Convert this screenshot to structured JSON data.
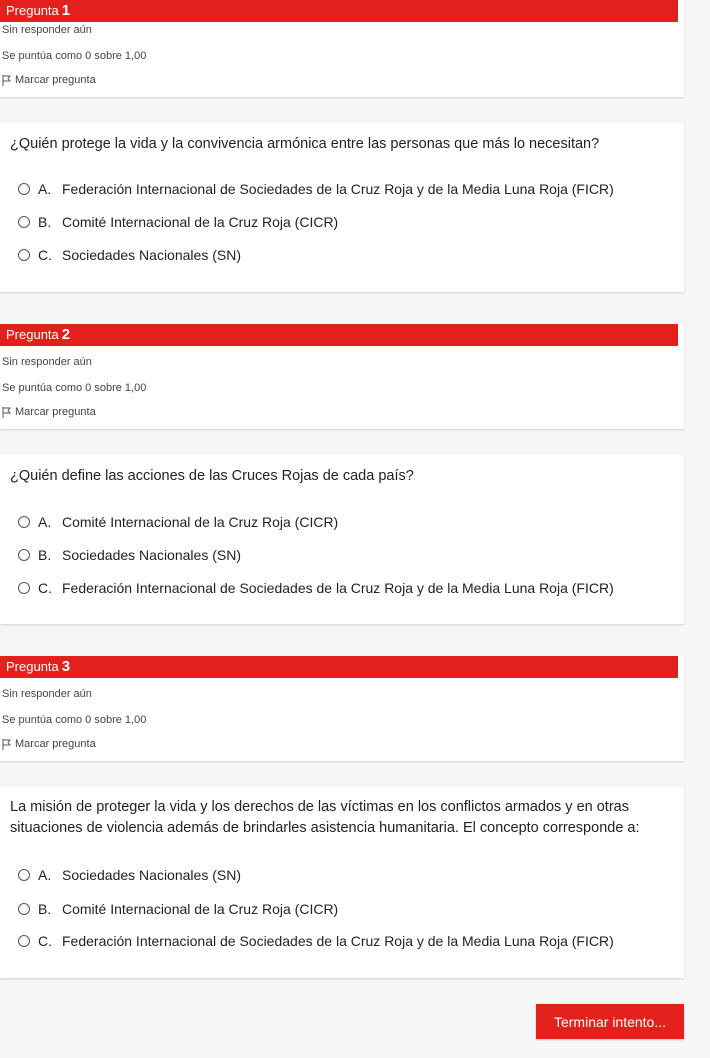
{
  "questions": [
    {
      "label": "Pregunta",
      "number": "1",
      "status": "Sin responder aún",
      "score": "Se puntúa como 0 sobre 1,00",
      "flag_label": "Marcar pregunta",
      "text": "¿Quién protege la vida y la convivencia armónica entre las personas que más lo necesitan?",
      "options": [
        {
          "letter": "A.",
          "text": "Federación Internacional de Sociedades de la Cruz Roja y de la Media Luna Roja (FICR)"
        },
        {
          "letter": "B.",
          "text": "Comité Internacional de la Cruz Roja (CICR)"
        },
        {
          "letter": "C.",
          "text": "Sociedades Nacionales (SN)"
        }
      ]
    },
    {
      "label": "Pregunta",
      "number": "2",
      "status": "Sin responder aún",
      "score": "Se puntúa como 0 sobre 1,00",
      "flag_label": "Marcar pregunta",
      "text": "¿Quién define las acciones de las Cruces Rojas de cada país?",
      "options": [
        {
          "letter": "A.",
          "text": "Comité Internacional de la Cruz Roja (CICR)"
        },
        {
          "letter": "B.",
          "text": "Sociedades Nacionales (SN)"
        },
        {
          "letter": "C.",
          "text": "Federación Internacional de Sociedades de la Cruz Roja y de la Media Luna Roja (FICR)"
        }
      ]
    },
    {
      "label": "Pregunta",
      "number": "3",
      "status": "Sin responder aún",
      "score": "Se puntúa como 0 sobre 1,00",
      "flag_label": "Marcar pregunta",
      "text": "La misión de proteger la vida y los derechos de las víctimas en los conflictos armados y en otras situaciones de violencia además de brindarles asistencia humanitaria. El concepto corresponde a:",
      "options": [
        {
          "letter": "A.",
          "text": "Sociedades Nacionales (SN)"
        },
        {
          "letter": "B.",
          "text": "Comité Internacional de la Cruz Roja (CICR)"
        },
        {
          "letter": "C.",
          "text": "Federación Internacional de Sociedades de la Cruz Roja y de la Media Luna Roja (FICR)"
        }
      ]
    }
  ],
  "finish_label": "Terminar intento...",
  "colors": {
    "accent": "#e3201b",
    "card": "#ffffff",
    "page": "#f6f6f6"
  }
}
